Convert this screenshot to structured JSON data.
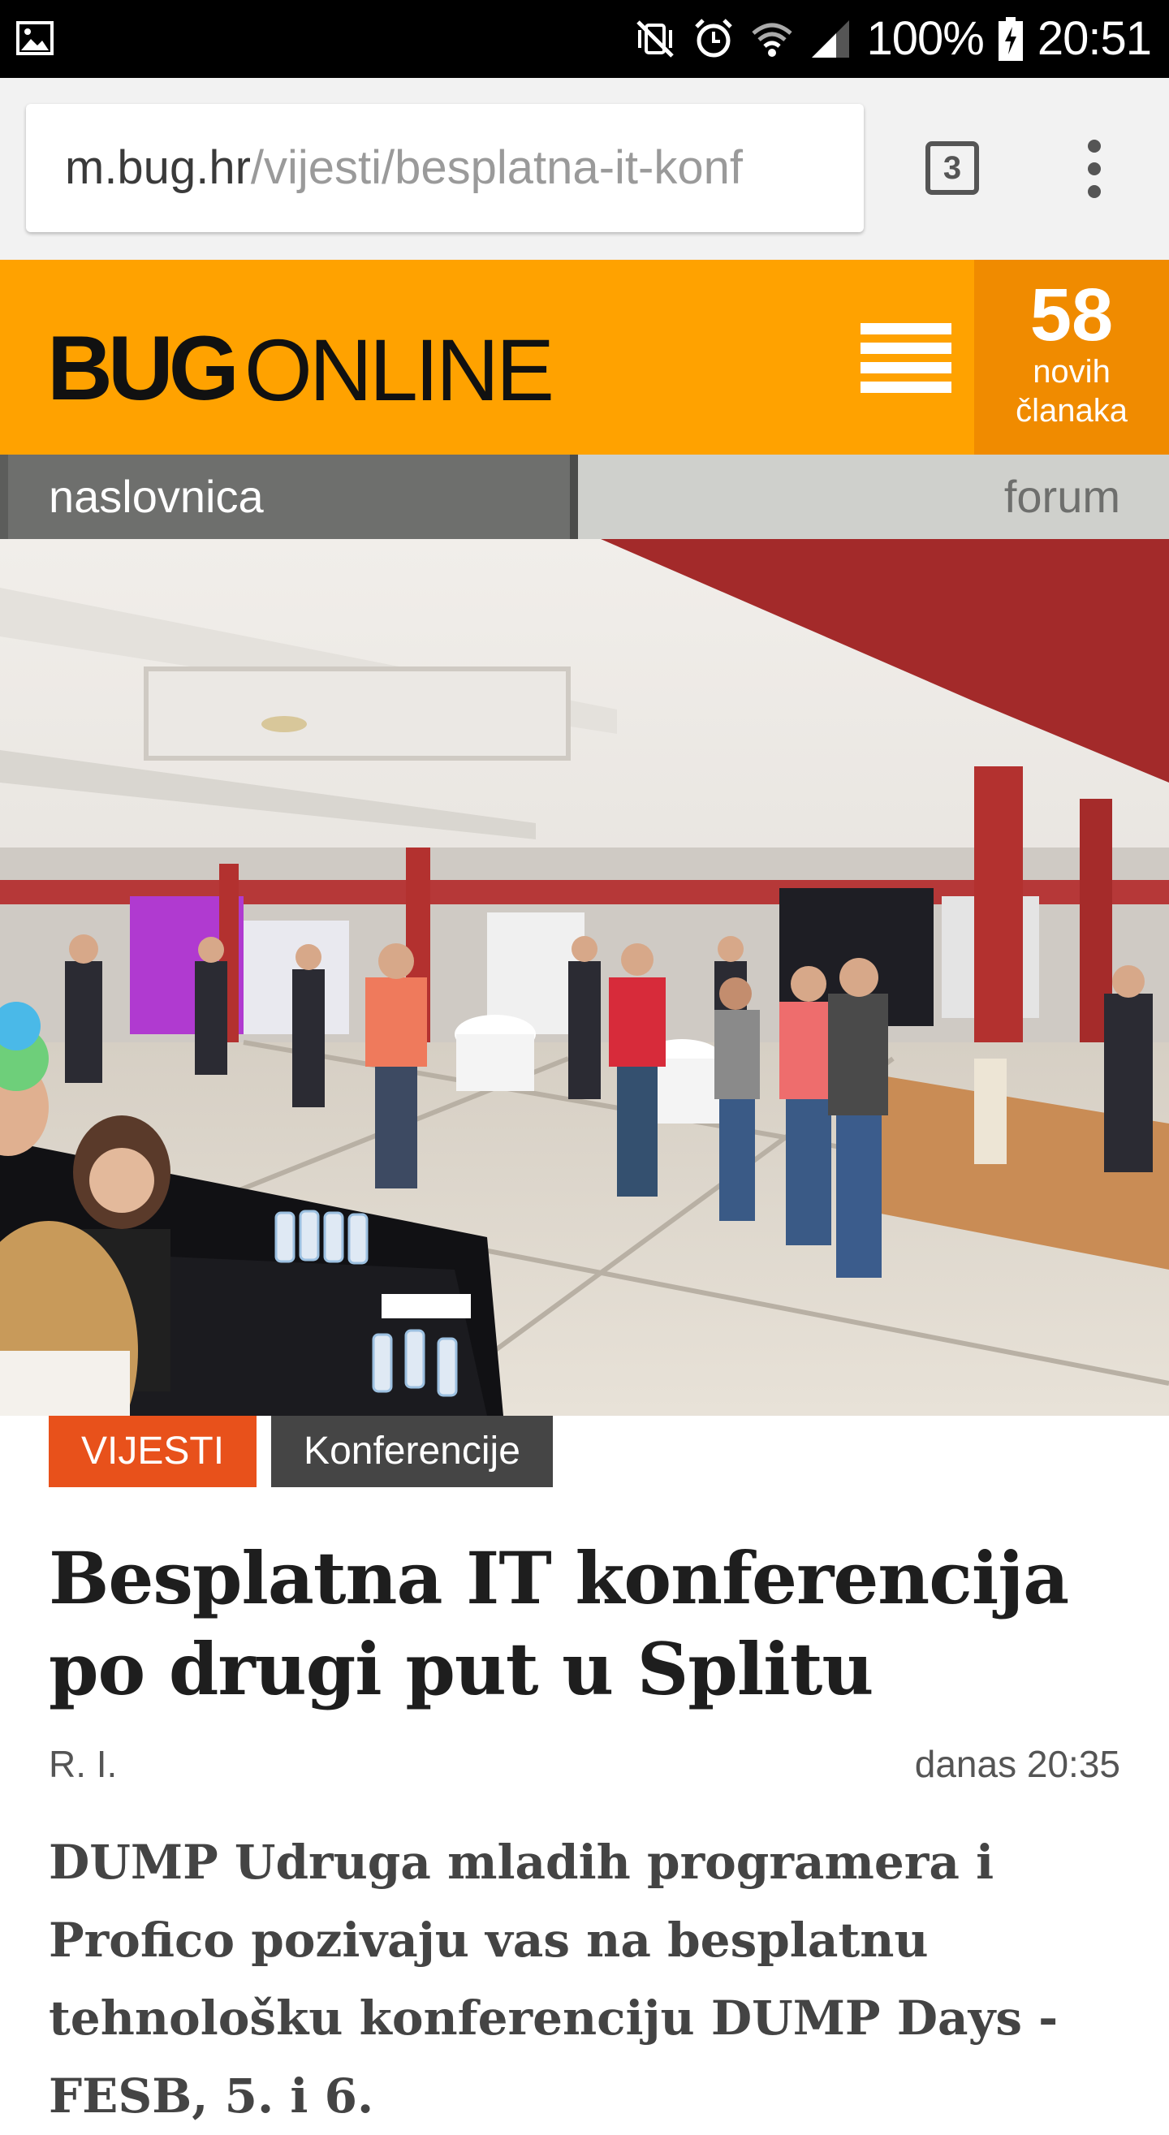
{
  "status_bar": {
    "battery": "100%",
    "time": "20:51",
    "icons": [
      "image-notification-icon",
      "mute-vibrate-icon",
      "alarm-icon",
      "wifi-icon",
      "signal-icon",
      "battery-charging-icon"
    ]
  },
  "browser": {
    "url_host": "m.bug.hr",
    "url_path": "/vijesti/besplatna-it-konf",
    "tab_count": "3",
    "menu_icon": "overflow-menu-icon"
  },
  "site": {
    "logo_bold": "BUG",
    "logo_light": "ONLINE",
    "menu_icon": "hamburger-icon",
    "new_count": "58",
    "new_label_1": "novih",
    "new_label_2": "članaka",
    "accent_color": "#ffa200"
  },
  "nav": {
    "home": "naslovnica",
    "forum": "forum"
  },
  "article": {
    "tags": [
      "VIJESTI",
      "Konferencije"
    ],
    "title": "Besplatna IT konferencija po drugi put u Splitu",
    "author": "R. I.",
    "date": "danas 20:35",
    "lead": "DUMP Udruga mladih programera i Profico pozivaju vas na besplatnu tehnološku konferenciju DUMP Days - FESB, 5. i 6."
  }
}
